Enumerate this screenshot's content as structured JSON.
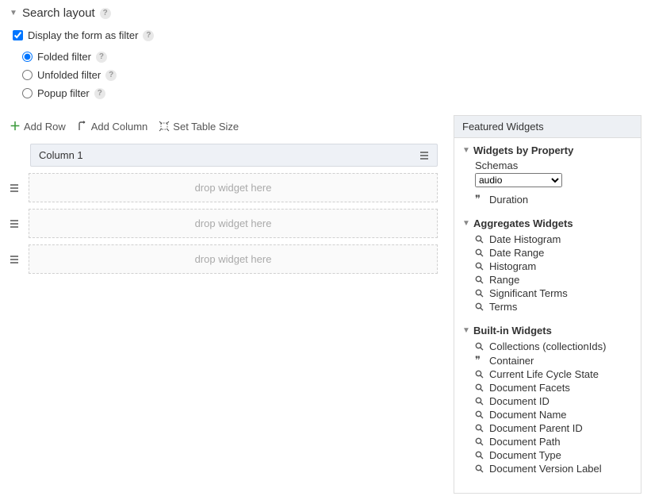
{
  "section": {
    "title": "Search layout"
  },
  "displayFilter": {
    "label": "Display the form as filter",
    "checked": true
  },
  "filterOptions": {
    "selected": "folded",
    "folded": {
      "label": "Folded filter"
    },
    "unfolded": {
      "label": "Unfolded filter"
    },
    "popup": {
      "label": "Popup filter"
    }
  },
  "toolbar": {
    "addRow": "Add Row",
    "addColumn": "Add Column",
    "setTableSize": "Set Table Size"
  },
  "table": {
    "column1": "Column 1",
    "dropHint1": "drop widget here",
    "dropHint2": "drop widget here",
    "dropHint3": "drop widget here"
  },
  "widgets": {
    "title": "Featured Widgets",
    "byProperty": {
      "title": "Widgets by Property",
      "schemasLabel": "Schemas",
      "schemaSelected": "audio",
      "items": {
        "duration": "Duration"
      }
    },
    "aggregates": {
      "title": "Aggregates Widgets",
      "items": {
        "dateHistogram": "Date Histogram",
        "dateRange": "Date Range",
        "histogram": "Histogram",
        "range": "Range",
        "significantTerms": "Significant Terms",
        "terms": "Terms"
      }
    },
    "builtin": {
      "title": "Built-in Widgets",
      "items": {
        "collections": "Collections (collectionIds)",
        "container": "Container",
        "lifecycle": "Current Life Cycle State",
        "facets": "Document Facets",
        "docId": "Document ID",
        "docName": "Document Name",
        "parentId": "Document Parent ID",
        "docPath": "Document Path",
        "docType": "Document Type",
        "versionLabel": "Document Version Label"
      }
    }
  }
}
